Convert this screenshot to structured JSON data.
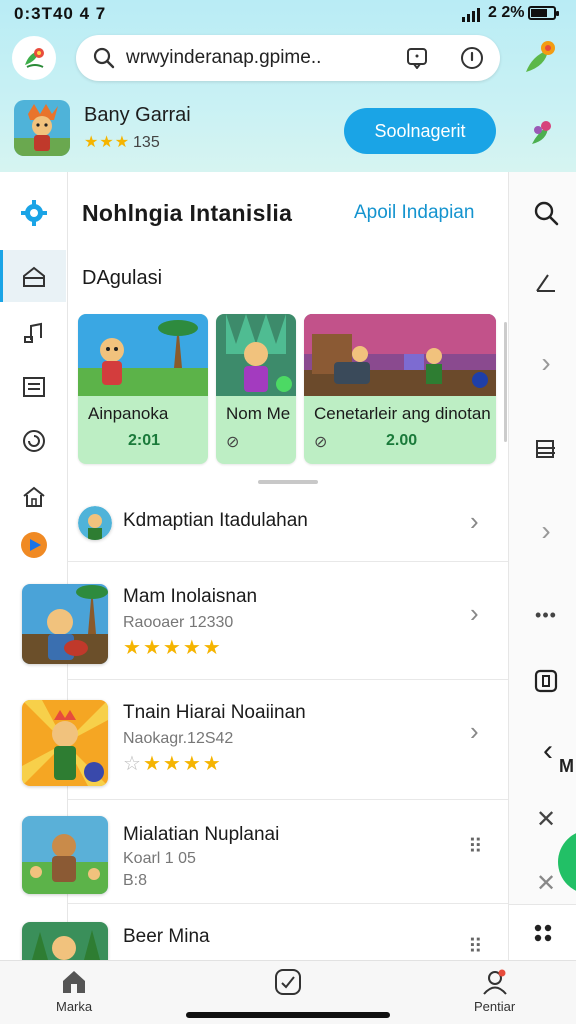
{
  "status": {
    "time": "0:3T40 4 7",
    "battery": "2 2%"
  },
  "search": {
    "query": "wrwyinderanap.gpime.."
  },
  "header": {
    "title": "Bany Garrai",
    "rating": "135",
    "button_label": "Soolnagerit"
  },
  "main": {
    "title": "Nohlngia Intanislia",
    "link": "Apoil Indapian",
    "section": "DAgulasi",
    "cards": [
      {
        "title": "Ainpanoka",
        "sub": "2:01"
      },
      {
        "title": "Nom Me",
        "sub": ""
      },
      {
        "title": "Cenetarleir ang dinotan",
        "sub": "2.00"
      }
    ],
    "list": [
      {
        "title": "Kdmaptian Itadulahan"
      },
      {
        "title": "Mam Inolaisnan",
        "sub": "Raooaer 12330",
        "stars": 5
      },
      {
        "title": "Tnain Hiarai Noaiinan",
        "sub": "Naokagr.12S42",
        "stars": 4
      },
      {
        "title": "Mialatian Nuplanai",
        "sub": "Koarl 1 05",
        "sub2": "B:8"
      },
      {
        "title": "Beer Mina"
      }
    ]
  },
  "right_rail": {
    "partial_label": "M"
  },
  "bottom_nav": {
    "left": "Marka",
    "right": "Pentiar"
  },
  "colors": {
    "accent": "#1aa4e6",
    "card_bg": "#bdeec4",
    "star": "#f5b400",
    "fab": "#22c066"
  }
}
